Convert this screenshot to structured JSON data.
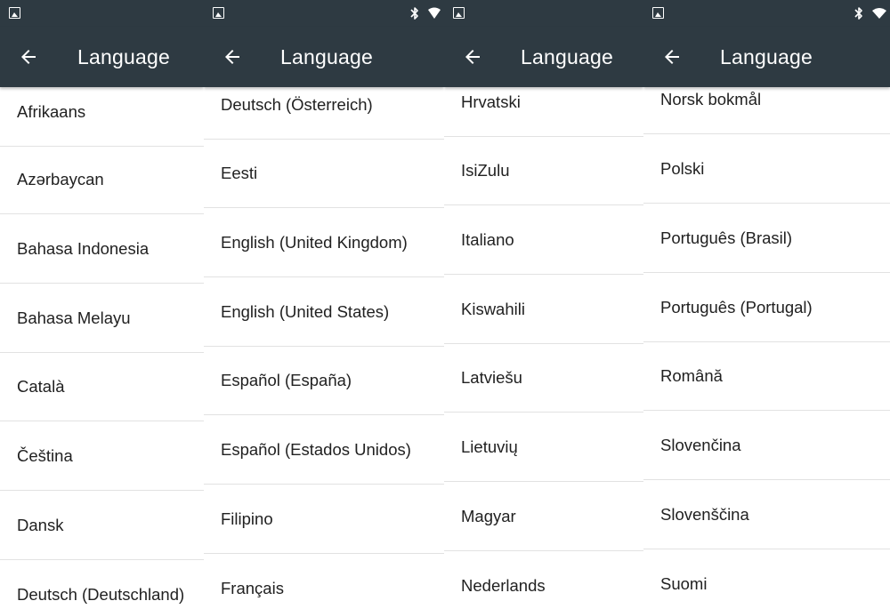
{
  "screens": [
    {
      "title": "Language",
      "items": [
        "Afrikaans",
        "Azərbaycan",
        "Bahasa Indonesia",
        "Bahasa Melayu",
        "Català",
        "Čeština",
        "Dansk",
        "Deutsch (Deutschland)"
      ]
    },
    {
      "title": "Language",
      "items": [
        "Deutsch (Österreich)",
        "Eesti",
        "English (United Kingdom)",
        "English (United States)",
        "Español (España)",
        "Español (Estados Unidos)",
        "Filipino",
        "Français"
      ]
    },
    {
      "title": "Language",
      "items": [
        "Hrvatski",
        "IsiZulu",
        "Italiano",
        "Kiswahili",
        "Latviešu",
        "Lietuvių",
        "Magyar",
        "Nederlands"
      ]
    },
    {
      "title": "Language",
      "items": [
        "Norsk bokmål",
        "Polski",
        "Português (Brasil)",
        "Português (Portugal)",
        "Română",
        "Slovenčina",
        "Slovenščina",
        "Suomi"
      ]
    }
  ],
  "icons": {
    "status_left": "image-notification-icon",
    "status_right": [
      "bluetooth-icon",
      "wifi-icon"
    ],
    "back": "arrow-back-icon"
  },
  "colors": {
    "appbar": "#2e3a42",
    "text": "#212121",
    "divider": "#e2e2e2"
  }
}
